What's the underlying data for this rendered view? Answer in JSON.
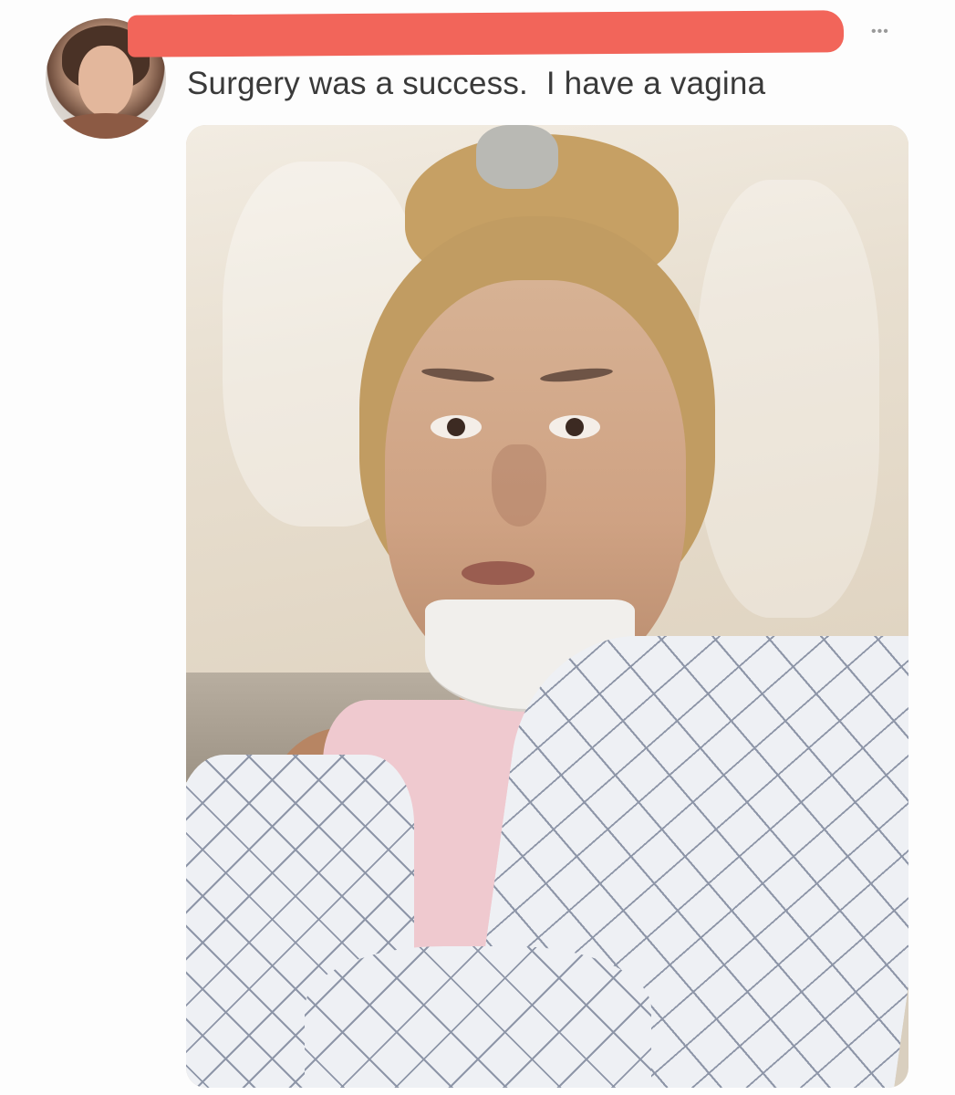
{
  "tweet": {
    "author_name_redacted": "",
    "text": "Surgery was a success.  I have a vagina",
    "more_icon": "more-options-icon",
    "more_glyph": "•••"
  },
  "colors": {
    "redaction": "#f2655a",
    "text": "#3a3a3a",
    "background": "#fdfdfd"
  }
}
